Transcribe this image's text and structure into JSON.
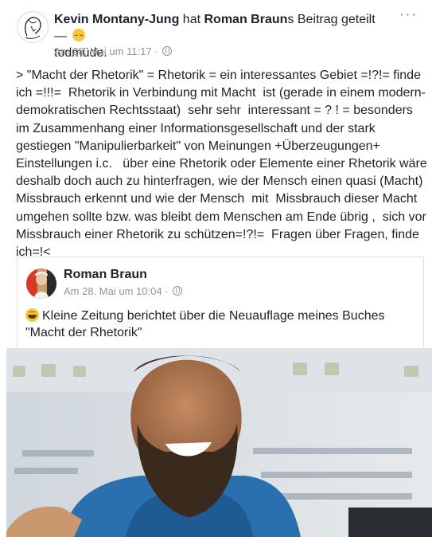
{
  "post": {
    "author": "Kevin Montany-Jung",
    "action": " hat ",
    "original_author_possessive": "Roman Braun",
    "action_suffix": "s Beitrag geteilt — ",
    "feeling": "todmüde.",
    "feeling_icon": "sleepy-face-emoji",
    "timestamp": "Am 28. Mai um 11:17",
    "separator": "·",
    "privacy_icon": "globe-icon",
    "more_label": "···",
    "body_lines": [
      "> \"Macht der Rhetorik\" = Rhetorik = ein interessantes Gebiet =!?!= finde",
      "ich =!!!=  Rhetorik in Verbindung mit Macht  ist (gerade in einem modern-",
      "demokratischen Rechtsstaat)  sehr sehr  interessant = ? ! = besonders",
      "im Zusammenhang einer Informationsgesellschaft und der stark",
      "gestiegen \"Manipulierbarkeit\" von Meinungen +Überzeugungen+",
      "Einstellungen i.c.   über eine Rhetorik oder Elemente einer Rhetorik wäre",
      "deshalb doch auch zu hinterfragen, wie der Mensch einen quasi (Macht)",
      "Missbrauch erkennt und wie der Mensch  mit  Missbrauch dieser Macht",
      "umgehen sollte bzw. was bleibt dem Menschen am Ende übrig ,  sich vor",
      "Missbrauch einer Rhetorik zu schützen=!?!=  Fragen über Fragen, finde",
      "ich=!<"
    ]
  },
  "shared_post": {
    "author": "Roman Braun",
    "timestamp": "Am 28. Mai um 10:04",
    "separator": "·",
    "privacy_icon": "globe-icon",
    "emoji": "laughing-face-emoji",
    "text_lines": [
      "Kleine Zeitung berichtet über die Neuauflage meines Buches",
      "\"Macht der Rhetorik\""
    ]
  },
  "colors": {
    "text": "#1d2129",
    "meta": "#90949c",
    "border": "#dddfe2",
    "background": "#ffffff"
  }
}
